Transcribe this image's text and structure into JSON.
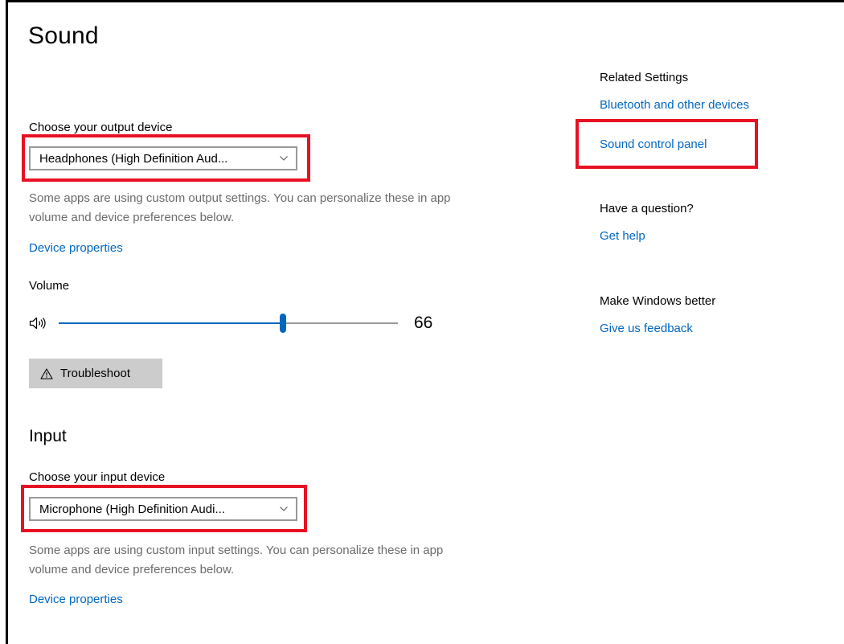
{
  "page": {
    "title": "Sound"
  },
  "output": {
    "choose_label": "Choose your output device",
    "selected_device": "Headphones (High Definition Aud...",
    "description": "Some apps are using custom output settings. You can personalize these in app volume and device preferences below.",
    "device_properties_link": "Device properties",
    "volume_label": "Volume",
    "volume_value": "66",
    "volume_percent": 66,
    "troubleshoot_label": "Troubleshoot"
  },
  "input": {
    "heading": "Input",
    "choose_label": "Choose your input device",
    "selected_device": "Microphone (High Definition Audi...",
    "description": "Some apps are using custom input settings. You can personalize these in app volume and device preferences below.",
    "device_properties_link": "Device properties"
  },
  "related": {
    "heading": "Related Settings",
    "bluetooth_link": "Bluetooth and other devices",
    "sound_control_panel_link": "Sound control panel",
    "question_heading": "Have a question?",
    "get_help_link": "Get help",
    "better_heading": "Make Windows better",
    "feedback_link": "Give us feedback"
  },
  "icons": {
    "speaker": "speaker-icon",
    "warning": "warning-icon",
    "chevron": "chevron-down-icon"
  },
  "colors": {
    "accent": "#0067c0",
    "highlight": "#e81123",
    "secondary_text": "#6b6b6b",
    "button_bg": "#cccccc"
  }
}
